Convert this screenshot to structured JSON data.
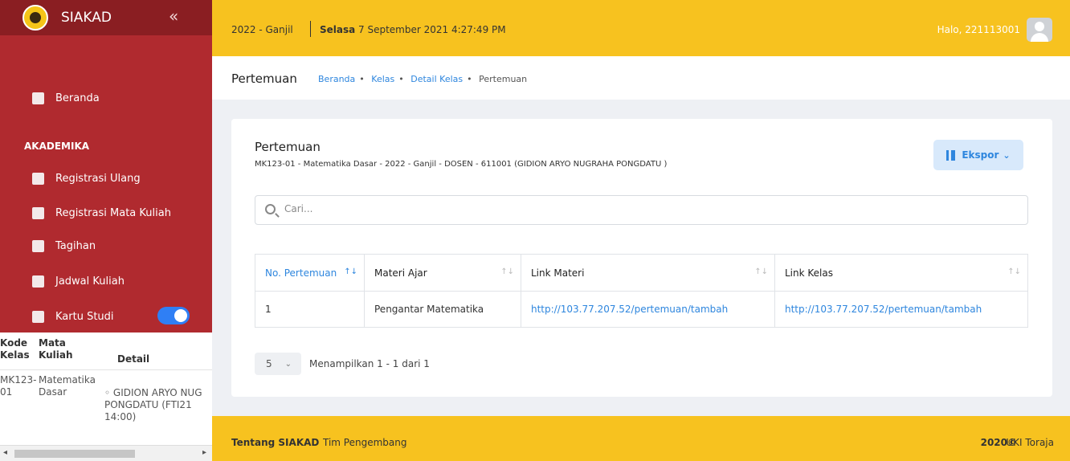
{
  "sidebar": {
    "brand": "SIAKAD",
    "collapse_icon": "«",
    "home_label": "Beranda",
    "section_label": "AKADEMIKA",
    "items": [
      {
        "label": "Registrasi Ulang",
        "icon": "edit-icon"
      },
      {
        "label": "Registrasi Mata Kuliah",
        "icon": "book-icon"
      },
      {
        "label": "Tagihan",
        "icon": "invoice-icon"
      },
      {
        "label": "Jadwal Kuliah",
        "icon": "calendar-icon"
      },
      {
        "label": "Kartu Studi",
        "icon": "document-icon"
      }
    ],
    "toggle_on": true
  },
  "leaked_table": {
    "headers": [
      "Kode Kelas",
      "Mata Kuliah",
      "Detail"
    ],
    "row": {
      "kode": "MK123-01",
      "matkul": "Matematika Dasar",
      "detail": "◦ GIDION ARYO NUG PONGDATU (FTI21 14:00)"
    }
  },
  "header": {
    "semester": "2022 - Ganjil",
    "day": "Selasa",
    "datetime": "7 September 2021  4:27:49 PM",
    "greeting": "Halo, 221113001"
  },
  "breadcrumb": {
    "title": "Pertemuan",
    "items": [
      "Beranda",
      "Kelas",
      "Detail Kelas"
    ],
    "current": "Pertemuan"
  },
  "card": {
    "title": "Pertemuan",
    "subtitle": "MK123-01 - Matematika Dasar - 2022 - Ganjil - DOSEN - 611001 (GIDION ARYO NUGRAHA PONGDATU )",
    "export_label": "Ekspor",
    "search_placeholder": "Cari...",
    "columns": [
      "No. Pertemuan",
      "Materi Ajar",
      "Link Materi",
      "Link Kelas"
    ],
    "rows": [
      {
        "no": "1",
        "materi": "Pengantar Matematika",
        "link_materi": "http://103.77.207.52/pertemuan/tambah",
        "link_kelas": "http://103.77.207.52/pertemuan/tambah"
      }
    ],
    "page_size": "5",
    "showing": "Menampilkan 1 - 1 dari 1"
  },
  "footer": {
    "about": "Tentang SIAKAD",
    "team": "Tim Pengembang",
    "year": "2020©",
    "org": "UKI Toraja"
  },
  "colors": {
    "sidebar": "#b02a2f",
    "brand_bar": "#8a1e22",
    "topbar": "#f7c21f",
    "accent": "#2e86de"
  }
}
